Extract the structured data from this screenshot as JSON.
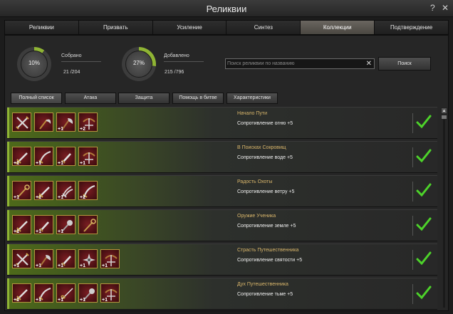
{
  "window": {
    "title": "Реликвии",
    "help_label": "?",
    "close_label": "✕"
  },
  "tabs": [
    {
      "label": "Реликвии",
      "active": false
    },
    {
      "label": "Призвать",
      "active": false
    },
    {
      "label": "Усиление",
      "active": false
    },
    {
      "label": "Синтез",
      "active": false
    },
    {
      "label": "Коллекции",
      "active": true
    },
    {
      "label": "Подтверждение",
      "active": false
    }
  ],
  "stats": {
    "collected": {
      "percent_label": "10%",
      "percent": 10,
      "label": "Собрано",
      "value": "21 /204"
    },
    "added": {
      "percent_label": "27%",
      "percent": 27,
      "label": "Добавлено",
      "value": "215 /796"
    }
  },
  "search": {
    "placeholder": "Поиск реликвии по названию",
    "value": "",
    "button_label": "Поиск",
    "clear_icon": "close-icon"
  },
  "filters": [
    {
      "label": "Полный список",
      "active": true
    },
    {
      "label": "Атака",
      "active": false
    },
    {
      "label": "Защита",
      "active": false
    },
    {
      "label": "Помощь в битве",
      "active": false
    },
    {
      "label": "Характеристики",
      "active": false
    }
  ],
  "colors": {
    "accent_green": "#8fb434",
    "slot_border": "#b6953e",
    "slot_fill": "#6a1a1f",
    "name_gold": "#d9b66b",
    "check_green": "#4dd32a"
  },
  "collections": [
    {
      "name": "Начало Пути",
      "bonus": "Сопротивление огню +5",
      "items": [
        {
          "icon": "crossed-swords-icon",
          "plus": ""
        },
        {
          "icon": "scythe-icon",
          "plus": ""
        },
        {
          "icon": "axe-icon",
          "plus": "+1"
        },
        {
          "icon": "crossbow-icon",
          "plus": "+2"
        }
      ]
    },
    {
      "name": "В Поисках Сокровищ",
      "bonus": "Сопротивление воде +5",
      "items": [
        {
          "icon": "sword-icon",
          "plus": "+1"
        },
        {
          "icon": "sabre-icon",
          "plus": "+1"
        },
        {
          "icon": "dagger-icon",
          "plus": "+1"
        },
        {
          "icon": "crossbow-icon",
          "plus": "+1"
        }
      ]
    },
    {
      "name": "Радость Охоты",
      "bonus": "Сопротивление ветру +5",
      "items": [
        {
          "icon": "staff-icon",
          "plus": "+1"
        },
        {
          "icon": "sword-icon",
          "plus": "+1"
        },
        {
          "icon": "claw-icon",
          "plus": "+1"
        },
        {
          "icon": "sabre-icon",
          "plus": "+2"
        }
      ]
    },
    {
      "name": "Оружие Ученика",
      "bonus": "Сопротивление земле +5",
      "items": [
        {
          "icon": "sword-icon",
          "plus": "+1"
        },
        {
          "icon": "dagger-icon",
          "plus": "+1"
        },
        {
          "icon": "mace-icon",
          "plus": "+1"
        },
        {
          "icon": "staff-icon",
          "plus": ""
        }
      ]
    },
    {
      "name": "Страсть Путешественника",
      "bonus": "Сопротивление святости +5",
      "items": [
        {
          "icon": "crossed-swords-icon",
          "plus": "+1"
        },
        {
          "icon": "axe-icon",
          "plus": "+1"
        },
        {
          "icon": "dagger-icon",
          "plus": "+1"
        },
        {
          "icon": "shuriken-icon",
          "plus": "+1"
        },
        {
          "icon": "crossbow-icon",
          "plus": "+1"
        }
      ]
    },
    {
      "name": "Дух Путешественника",
      "bonus": "Сопротивление тьме +5",
      "items": [
        {
          "icon": "sword-icon",
          "plus": "+1"
        },
        {
          "icon": "sabre-icon",
          "plus": "+1"
        },
        {
          "icon": "rapier-icon",
          "plus": "+1"
        },
        {
          "icon": "mace-icon",
          "plus": "+1"
        },
        {
          "icon": "crossbow-icon",
          "plus": "+1"
        }
      ]
    }
  ]
}
